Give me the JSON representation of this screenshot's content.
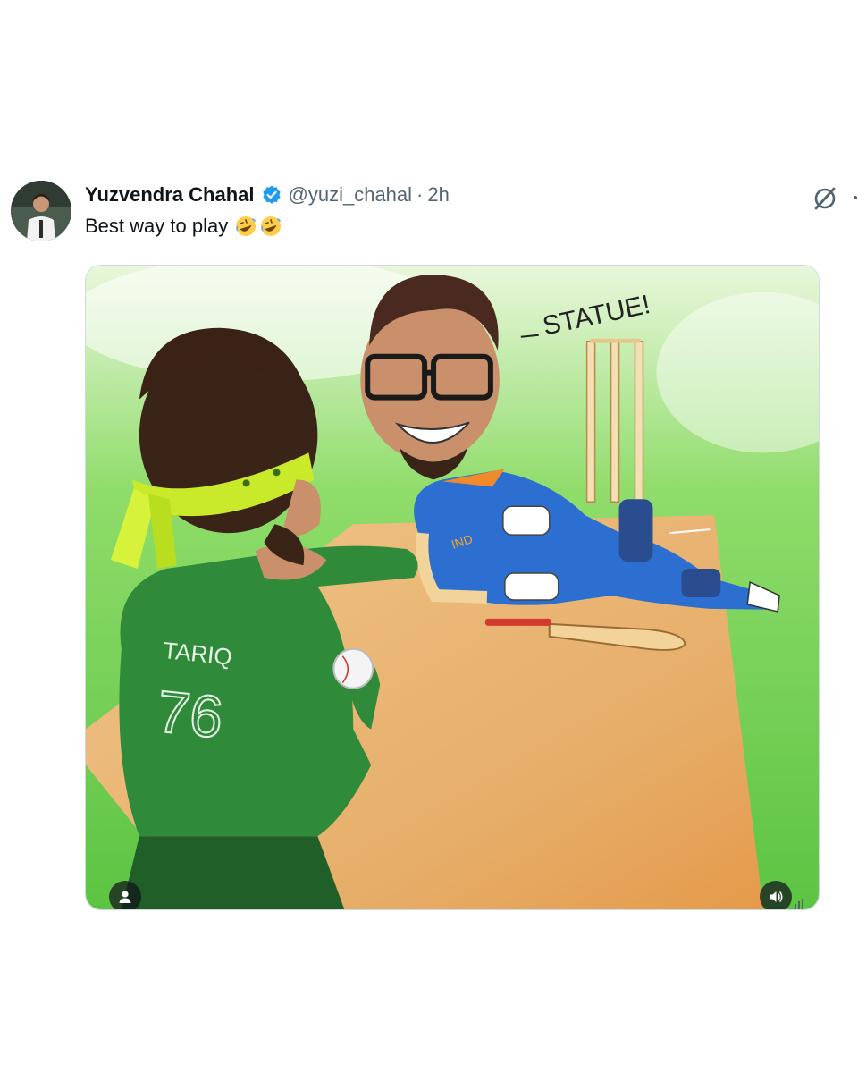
{
  "tweet": {
    "author_name": "Yuzvendra Chahal",
    "handle": "@yuzi_chahal",
    "separator": "·",
    "time": "2h",
    "text": "Best way to play",
    "emojis": [
      "rolling-on-floor-laughing-emoji",
      "rolling-on-floor-laughing-emoji"
    ]
  },
  "media": {
    "speech_bubble": "STATUE!",
    "jersey_name": "TARIQ",
    "jersey_number": "76",
    "batsman_jersey_text": "IND"
  },
  "colors": {
    "verified_blue": "#1d9bf0",
    "muted_text": "#536471",
    "pitch": "#e3b57a",
    "field_green": "#6fce52",
    "india_blue": "#2d6fd1",
    "pakistan_green": "#2f8a3a"
  },
  "icons": [
    "verified-badge-icon",
    "grok-icon",
    "more-icon",
    "tag-people-icon",
    "volume-icon"
  ]
}
